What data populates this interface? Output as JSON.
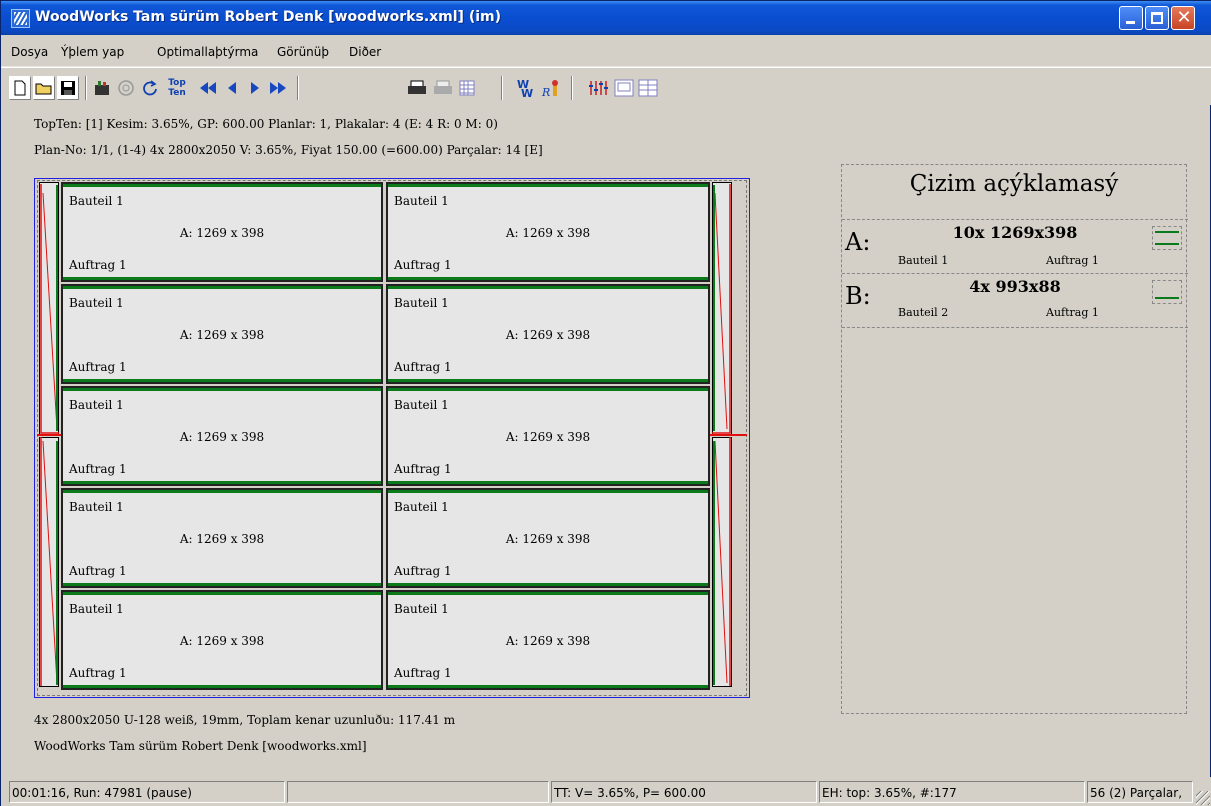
{
  "window": {
    "title": "WoodWorks Tam sürüm Robert Denk [woodworks.xml] (im)"
  },
  "menu": {
    "items": [
      "Dosya",
      "Ýþlem yap",
      "Optimallaþtýrma",
      "Görünüþ",
      "Diðer"
    ]
  },
  "toolbar": {
    "icons": [
      "new-file-icon",
      "open-folder-icon",
      "save-icon",
      "machine-icon",
      "target-icon",
      "refresh-icon",
      "top-ten-icon",
      "first-icon",
      "previous-icon",
      "next-icon",
      "last-icon",
      "print-icon",
      "print-preview-icon",
      "grid-icon",
      "woodworks-icon",
      "report-icon",
      "sliders-icon",
      "layout-icon",
      "panels-icon"
    ],
    "top_ten_label_1": "Top",
    "top_ten_label_2": "Ten"
  },
  "info": {
    "line1": "TopTen: [1] Kesim:  3.65%, GP: 600.00 Planlar: 1, Plakalar: 4 (E: 4 R: 0 M: 0)",
    "line2": "Plan-No: 1/1, (1-4) 4x 2800x2050 V:  3.65%, Fiyat 150.00 (=600.00) Parçalar: 14   [E]"
  },
  "plan": {
    "parts": [
      {
        "name": "Bauteil 1",
        "dim": "A: 1269 x 398",
        "order": "Auftrag 1"
      },
      {
        "name": "Bauteil 1",
        "dim": "A: 1269 x 398",
        "order": "Auftrag 1"
      },
      {
        "name": "Bauteil 1",
        "dim": "A: 1269 x 398",
        "order": "Auftrag 1"
      },
      {
        "name": "Bauteil 1",
        "dim": "A: 1269 x 398",
        "order": "Auftrag 1"
      },
      {
        "name": "Bauteil 1",
        "dim": "A: 1269 x 398",
        "order": "Auftrag 1"
      },
      {
        "name": "Bauteil 1",
        "dim": "A: 1269 x 398",
        "order": "Auftrag 1"
      },
      {
        "name": "Bauteil 1",
        "dim": "A: 1269 x 398",
        "order": "Auftrag 1"
      },
      {
        "name": "Bauteil 1",
        "dim": "A: 1269 x 398",
        "order": "Auftrag 1"
      },
      {
        "name": "Bauteil 1",
        "dim": "A: 1269 x 398",
        "order": "Auftrag 1"
      },
      {
        "name": "Bauteil 1",
        "dim": "A: 1269 x 398",
        "order": "Auftrag 1"
      }
    ]
  },
  "legend": {
    "title": "Çizim açýklamasý",
    "rows": [
      {
        "letter": "A:",
        "dim": "10x 1269x398",
        "part": "Bauteil 1",
        "order": "Auftrag 1"
      },
      {
        "letter": "B:",
        "dim": "4x 993x88",
        "part": "Bauteil 2",
        "order": "Auftrag 1"
      }
    ]
  },
  "footer": {
    "line1": "4x 2800x2050 U-128 weiß, 19mm, Toplam kenar uzunluðu: 117.41 m",
    "line2": "WoodWorks Tam sürüm Robert Denk [woodworks.xml]"
  },
  "status": {
    "time_run": "00:01:16, Run: 47981 (pause)",
    "empty": "",
    "tt": "TT: V= 3.65%, P= 600.00",
    "eh": "EH: top: 3.65%,  #:177",
    "parts": "56 (2) Parçalar,"
  },
  "colors": {
    "title_bar": "#0a4ed0",
    "edge_green": "#0b7a1a",
    "cut_red": "#e01010",
    "sheet_border_blue": "#2020e0"
  }
}
